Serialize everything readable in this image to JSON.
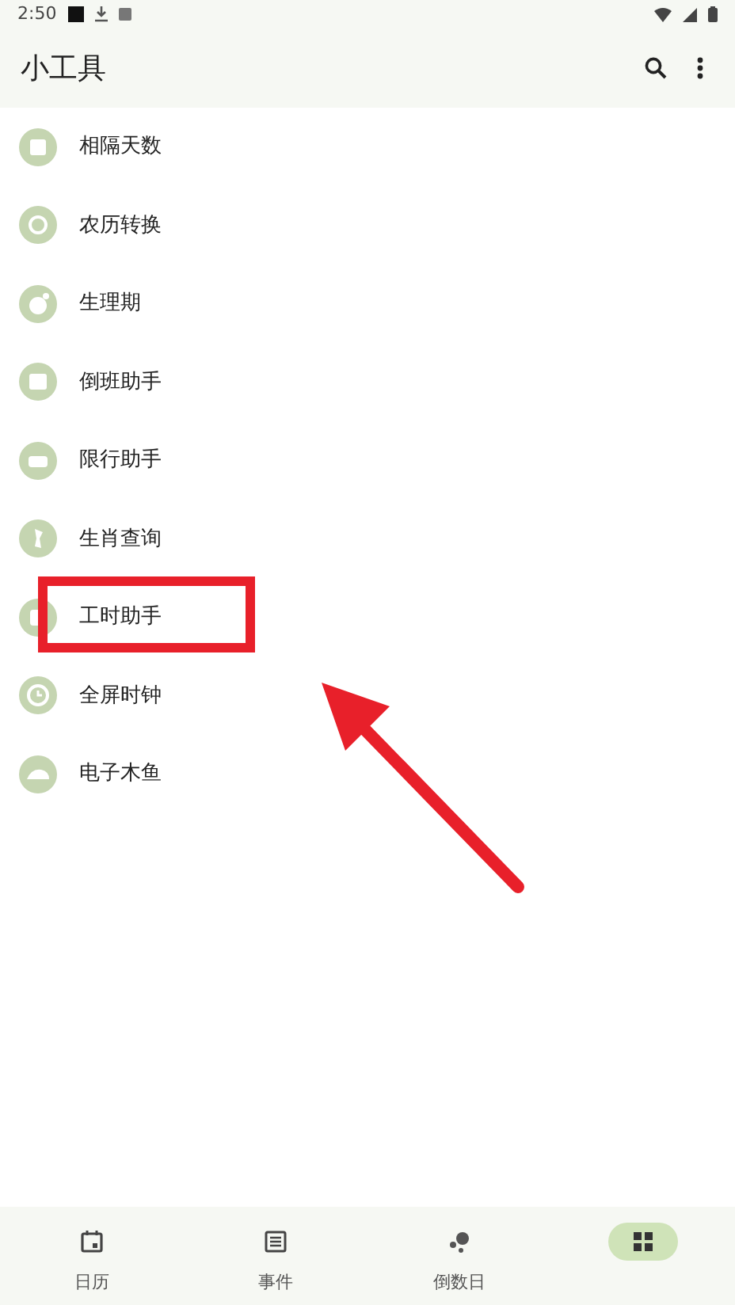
{
  "status_bar": {
    "time": "2:50"
  },
  "app_bar": {
    "title": "小工具"
  },
  "tools": [
    {
      "label": "相隔天数",
      "highlighted": false
    },
    {
      "label": "农历转换",
      "highlighted": false
    },
    {
      "label": "生理期",
      "highlighted": false
    },
    {
      "label": "倒班助手",
      "highlighted": false
    },
    {
      "label": "限行助手",
      "highlighted": false
    },
    {
      "label": "生肖查询",
      "highlighted": false
    },
    {
      "label": "工时助手",
      "highlighted": true
    },
    {
      "label": "全屏时钟",
      "highlighted": false
    },
    {
      "label": "电子木鱼",
      "highlighted": false
    }
  ],
  "bottom_nav": [
    {
      "label": "日历",
      "selected": false
    },
    {
      "label": "事件",
      "selected": false
    },
    {
      "label": "倒数日",
      "selected": false
    },
    {
      "selected": true
    }
  ]
}
